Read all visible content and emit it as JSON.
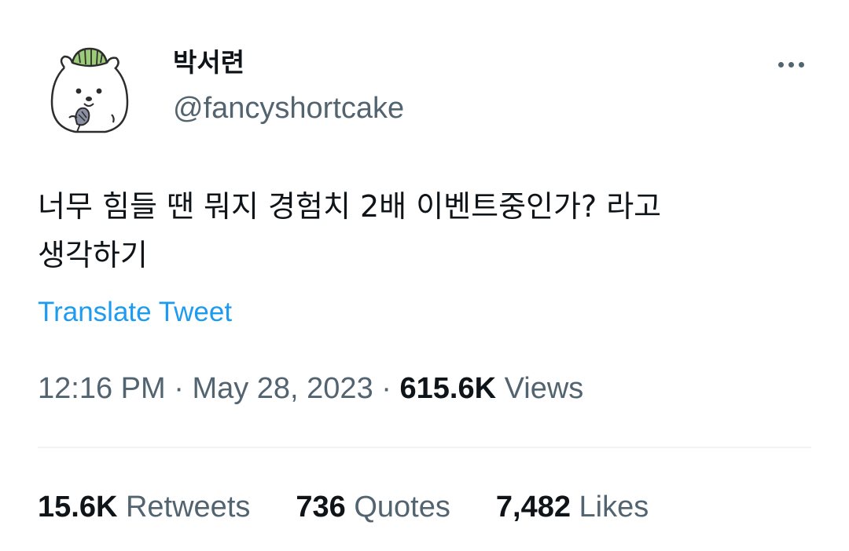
{
  "author": {
    "display_name": "박서련",
    "handle": "@fancyshortcake",
    "avatar": "bear-with-lettuce-hat-avatar"
  },
  "more_icon": "more-horizontal-icon",
  "tweet": {
    "text_line1": "너무 힘들 땐 뭐지 경험치 2배 이벤트중인가? 라고",
    "text_line2": "생각하기",
    "translate_label": "Translate Tweet"
  },
  "meta": {
    "time": "12:16 PM",
    "separator": " · ",
    "date": "May 28, 2023",
    "views_count": "615.6K",
    "views_label": "Views"
  },
  "stats": {
    "retweets_count": "15.6K",
    "retweets_label": "Retweets",
    "quotes_count": "736",
    "quotes_label": "Quotes",
    "likes_count": "7,482",
    "likes_label": "Likes"
  },
  "colors": {
    "text_primary": "#0f1419",
    "text_secondary": "#536471",
    "link": "#1d9bf0",
    "divider": "#eff3f4",
    "avatar_hat": "#9ccc7a"
  }
}
